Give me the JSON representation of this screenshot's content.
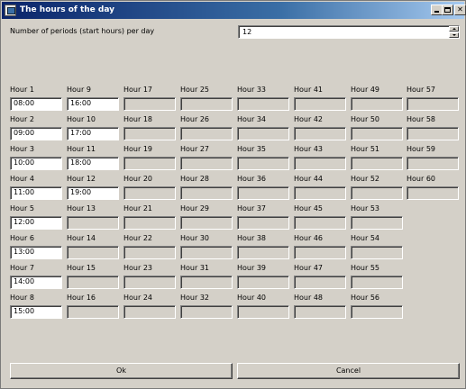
{
  "window": {
    "title": "The hours of the day",
    "controls": {
      "minimize": "minimize",
      "maximize": "maximize",
      "close": "✕"
    }
  },
  "periods": {
    "label": "Number of periods (start hours) per day",
    "value": "12"
  },
  "hours": [
    {
      "label": "Hour 1",
      "value": "08:00",
      "enabled": true
    },
    {
      "label": "Hour 2",
      "value": "09:00",
      "enabled": true
    },
    {
      "label": "Hour 3",
      "value": "10:00",
      "enabled": true
    },
    {
      "label": "Hour 4",
      "value": "11:00",
      "enabled": true
    },
    {
      "label": "Hour 5",
      "value": "12:00",
      "enabled": true
    },
    {
      "label": "Hour 6",
      "value": "13:00",
      "enabled": true
    },
    {
      "label": "Hour 7",
      "value": "14:00",
      "enabled": true
    },
    {
      "label": "Hour 8",
      "value": "15:00",
      "enabled": true
    },
    {
      "label": "Hour 9",
      "value": "16:00",
      "enabled": true
    },
    {
      "label": "Hour 10",
      "value": "17:00",
      "enabled": true
    },
    {
      "label": "Hour 11",
      "value": "18:00",
      "enabled": true
    },
    {
      "label": "Hour 12",
      "value": "19:00",
      "enabled": true
    },
    {
      "label": "Hour 13",
      "value": "",
      "enabled": false
    },
    {
      "label": "Hour 14",
      "value": "",
      "enabled": false
    },
    {
      "label": "Hour 15",
      "value": "",
      "enabled": false
    },
    {
      "label": "Hour 16",
      "value": "",
      "enabled": false
    },
    {
      "label": "Hour 17",
      "value": "",
      "enabled": false
    },
    {
      "label": "Hour 18",
      "value": "",
      "enabled": false
    },
    {
      "label": "Hour 19",
      "value": "",
      "enabled": false
    },
    {
      "label": "Hour 20",
      "value": "",
      "enabled": false
    },
    {
      "label": "Hour 21",
      "value": "",
      "enabled": false
    },
    {
      "label": "Hour 22",
      "value": "",
      "enabled": false
    },
    {
      "label": "Hour 23",
      "value": "",
      "enabled": false
    },
    {
      "label": "Hour 24",
      "value": "",
      "enabled": false
    },
    {
      "label": "Hour 25",
      "value": "",
      "enabled": false
    },
    {
      "label": "Hour 26",
      "value": "",
      "enabled": false
    },
    {
      "label": "Hour 27",
      "value": "",
      "enabled": false
    },
    {
      "label": "Hour 28",
      "value": "",
      "enabled": false
    },
    {
      "label": "Hour 29",
      "value": "",
      "enabled": false
    },
    {
      "label": "Hour 30",
      "value": "",
      "enabled": false
    },
    {
      "label": "Hour 31",
      "value": "",
      "enabled": false
    },
    {
      "label": "Hour 32",
      "value": "",
      "enabled": false
    },
    {
      "label": "Hour 33",
      "value": "",
      "enabled": false
    },
    {
      "label": "Hour 34",
      "value": "",
      "enabled": false
    },
    {
      "label": "Hour 35",
      "value": "",
      "enabled": false
    },
    {
      "label": "Hour 36",
      "value": "",
      "enabled": false
    },
    {
      "label": "Hour 37",
      "value": "",
      "enabled": false
    },
    {
      "label": "Hour 38",
      "value": "",
      "enabled": false
    },
    {
      "label": "Hour 39",
      "value": "",
      "enabled": false
    },
    {
      "label": "Hour 40",
      "value": "",
      "enabled": false
    },
    {
      "label": "Hour 41",
      "value": "",
      "enabled": false
    },
    {
      "label": "Hour 42",
      "value": "",
      "enabled": false
    },
    {
      "label": "Hour 43",
      "value": "",
      "enabled": false
    },
    {
      "label": "Hour 44",
      "value": "",
      "enabled": false
    },
    {
      "label": "Hour 45",
      "value": "",
      "enabled": false
    },
    {
      "label": "Hour 46",
      "value": "",
      "enabled": false
    },
    {
      "label": "Hour 47",
      "value": "",
      "enabled": false
    },
    {
      "label": "Hour 48",
      "value": "",
      "enabled": false
    },
    {
      "label": "Hour 49",
      "value": "",
      "enabled": false
    },
    {
      "label": "Hour 50",
      "value": "",
      "enabled": false
    },
    {
      "label": "Hour 51",
      "value": "",
      "enabled": false
    },
    {
      "label": "Hour 52",
      "value": "",
      "enabled": false
    },
    {
      "label": "Hour 53",
      "value": "",
      "enabled": false
    },
    {
      "label": "Hour 54",
      "value": "",
      "enabled": false
    },
    {
      "label": "Hour 55",
      "value": "",
      "enabled": false
    },
    {
      "label": "Hour 56",
      "value": "",
      "enabled": false
    },
    {
      "label": "Hour 57",
      "value": "",
      "enabled": false
    },
    {
      "label": "Hour 58",
      "value": "",
      "enabled": false
    },
    {
      "label": "Hour 59",
      "value": "",
      "enabled": false
    },
    {
      "label": "Hour 60",
      "value": "",
      "enabled": false
    }
  ],
  "buttons": {
    "ok": "Ok",
    "cancel": "Cancel"
  }
}
